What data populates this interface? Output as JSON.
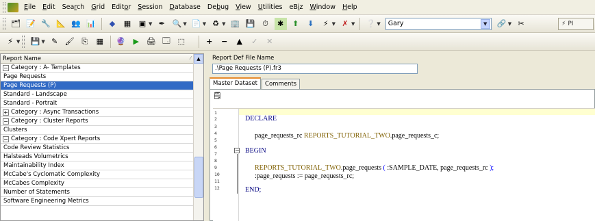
{
  "menu": [
    "Eile",
    "Edit",
    "Search",
    "Grid",
    "Editor",
    "Session",
    "Database",
    "Debug",
    "View",
    "Utilities",
    "eBiz",
    "Window",
    "Help"
  ],
  "menu_underline": [
    0,
    0,
    3,
    0,
    4,
    0,
    0,
    2,
    0,
    0,
    2,
    0,
    0
  ],
  "toolbar": {
    "user_value": "Gary",
    "right_button_label": "PI"
  },
  "left_pane": {
    "header": "Report Name",
    "rows": [
      {
        "label": "Category : A- Templates",
        "type": "category",
        "expander": "−"
      },
      {
        "label": "Page Requests",
        "type": "child"
      },
      {
        "label": "Page Requests (P)",
        "type": "child",
        "selected": true
      },
      {
        "label": "Standard - Landscape",
        "type": "child"
      },
      {
        "label": "Standard - Portrait",
        "type": "child"
      },
      {
        "label": "Category : Async Transactions",
        "type": "category",
        "expander": "+"
      },
      {
        "label": "Category : Cluster Reports",
        "type": "category",
        "expander": "−"
      },
      {
        "label": "Clusters",
        "type": "child"
      },
      {
        "label": "Category : Code Xpert Reports",
        "type": "category",
        "expander": "−"
      },
      {
        "label": "Code Review Statistics",
        "type": "child"
      },
      {
        "label": "Halsteads Volumetrics",
        "type": "child"
      },
      {
        "label": "Maintainability Index",
        "type": "child"
      },
      {
        "label": "McCabe's Cyclomatic Complexity",
        "type": "child"
      },
      {
        "label": "McCabes Complexity",
        "type": "child"
      },
      {
        "label": "Number of Statements",
        "type": "child"
      },
      {
        "label": "Software Engineering Metrics",
        "type": "child"
      }
    ]
  },
  "right_pane": {
    "file_label": "Report Def File Name",
    "file_value": ".\\Page Requests (P).fr3",
    "tabs": [
      "Master Dataset",
      "Comments"
    ],
    "line_numbers": [
      "1",
      "2",
      "3",
      "4",
      "5",
      "6",
      "7",
      "8",
      "9",
      "10",
      "11",
      "12"
    ],
    "code": {
      "declare": "DECLARE",
      "decl_var": "page_requests_rc ",
      "decl_type": "REPORTS_TUTORIAL_TWO",
      "decl_rest": ".page_requests_c;",
      "begin": "BEGIN",
      "call_obj": "REPORTS_TUTORIAL_TWO",
      "call_rest_a": ".page_requests ",
      "call_paren_open": "( ",
      "call_args": ":SAMPLE_DATE, page_requests_rc ",
      "call_paren_close": ");",
      "assign": ":page_requests := page_requests_rc;",
      "end": "END;"
    }
  }
}
